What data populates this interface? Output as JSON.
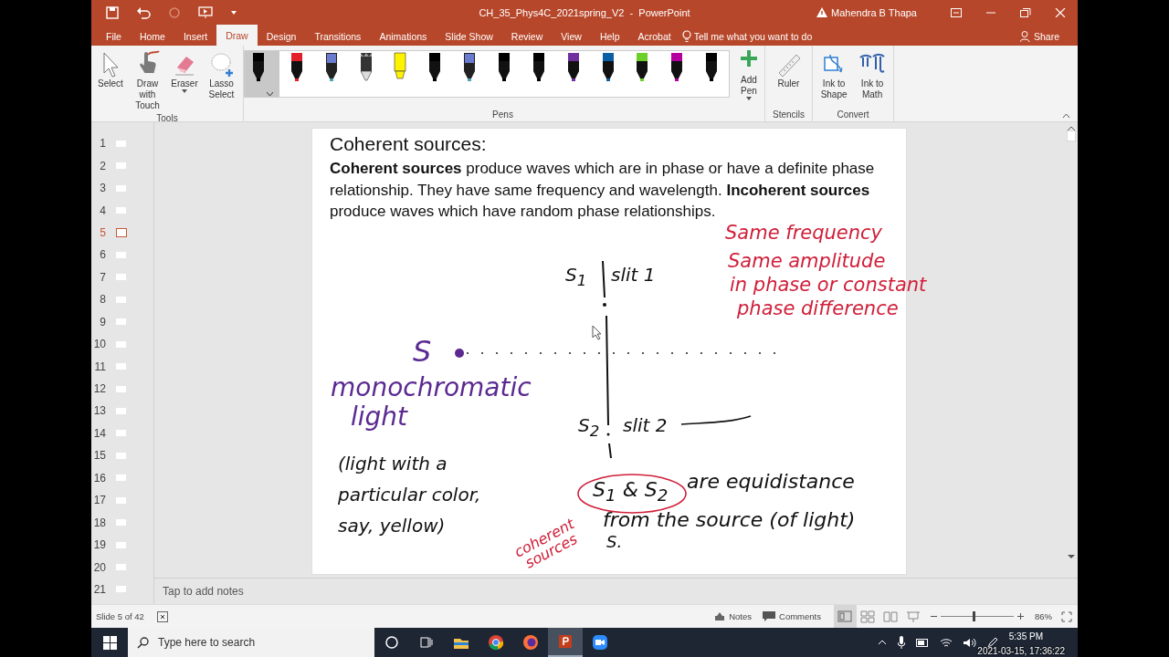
{
  "window": {
    "title": "CH_35_Phys4C_2021spring_V2  -  PowerPoint",
    "user": "Mahendra B Thapa"
  },
  "tabs": [
    {
      "label": "File",
      "selected": false
    },
    {
      "label": "Home",
      "selected": false
    },
    {
      "label": "Insert",
      "selected": false
    },
    {
      "label": "Draw",
      "selected": true
    },
    {
      "label": "Design",
      "selected": false
    },
    {
      "label": "Transitions",
      "selected": false
    },
    {
      "label": "Animations",
      "selected": false
    },
    {
      "label": "Slide Show",
      "selected": false
    },
    {
      "label": "Review",
      "selected": false
    },
    {
      "label": "View",
      "selected": false
    },
    {
      "label": "Help",
      "selected": false
    },
    {
      "label": "Acrobat",
      "selected": false
    }
  ],
  "tell_me": "Tell me what you want to do",
  "share": "Share",
  "ribbon": {
    "tools": {
      "label": "Tools",
      "buttons": [
        {
          "label": "Select",
          "dropdown": false
        },
        {
          "label": "Draw with Touch",
          "dropdown": false
        },
        {
          "label": "Eraser",
          "dropdown": true
        },
        {
          "label": "Lasso Select",
          "dropdown": false
        }
      ]
    },
    "pens": {
      "label": "Pens",
      "add_pen": "Add Pen",
      "items": [
        {
          "kind": "pen",
          "color": "#000000",
          "selected": true
        },
        {
          "kind": "pen",
          "color": "#e3202a",
          "selected": false
        },
        {
          "kind": "galaxy",
          "color": "#4fa3b8",
          "selected": false
        },
        {
          "kind": "pencil",
          "color": "#9a9a9a",
          "selected": false
        },
        {
          "kind": "highlighter",
          "color": "#fff200",
          "selected": false
        },
        {
          "kind": "pen",
          "color": "#000000",
          "selected": false
        },
        {
          "kind": "galaxy",
          "color": "#4fa3b8",
          "selected": false
        },
        {
          "kind": "pen",
          "color": "#000000",
          "selected": false
        },
        {
          "kind": "pen",
          "color": "#000000",
          "selected": false
        },
        {
          "kind": "pen",
          "color": "#7030a0",
          "selected": false
        },
        {
          "kind": "pen",
          "color": "#0b5fa5",
          "selected": false
        },
        {
          "kind": "pen",
          "color": "#6ccf2a",
          "selected": false
        },
        {
          "kind": "pen",
          "color": "#b4009e",
          "selected": false
        },
        {
          "kind": "pen",
          "color": "#000000",
          "selected": false
        }
      ]
    },
    "stencils": {
      "label": "Stencils",
      "buttons": [
        {
          "label": "Ruler"
        }
      ]
    },
    "convert": {
      "label": "Convert",
      "buttons": [
        {
          "label": "Ink to Shape"
        },
        {
          "label": "Ink to Math"
        }
      ]
    }
  },
  "thumbnails": [
    {
      "number": "1",
      "selected": false
    },
    {
      "number": "2",
      "selected": false
    },
    {
      "number": "3",
      "selected": false
    },
    {
      "number": "4",
      "selected": false
    },
    {
      "number": "5",
      "selected": true
    },
    {
      "number": "6",
      "selected": false
    },
    {
      "number": "7",
      "selected": false
    },
    {
      "number": "8",
      "selected": false
    },
    {
      "number": "9",
      "selected": false
    },
    {
      "number": "10",
      "selected": false
    },
    {
      "number": "11",
      "selected": false
    },
    {
      "number": "12",
      "selected": false
    },
    {
      "number": "13",
      "selected": false
    },
    {
      "number": "14",
      "selected": false
    },
    {
      "number": "15",
      "selected": false
    },
    {
      "number": "16",
      "selected": false
    },
    {
      "number": "17",
      "selected": false
    },
    {
      "number": "18",
      "selected": false
    },
    {
      "number": "19",
      "selected": false
    },
    {
      "number": "20",
      "selected": false
    },
    {
      "number": "21",
      "selected": false
    }
  ],
  "slide": {
    "title": "Coherent sources:",
    "body": "**Coherent sources** produce waves which are in phase or have a definite phase relationship. They have same frequency and wavelength. **Incoherent sources** produce waves which have random phase relationships.",
    "ink": [
      {
        "text": "Same frequency",
        "color": "#d0203a"
      },
      {
        "text": "Same amplitude",
        "color": "#d0203a"
      },
      {
        "text": "in phase or constant",
        "color": "#d0203a"
      },
      {
        "text": "phase difference",
        "color": "#d0203a"
      },
      {
        "text": "S$_{1}$",
        "color": "#111111"
      },
      {
        "text": "slit 1",
        "color": "#111111"
      },
      {
        "text": "S",
        "color": "#5b2a91"
      },
      {
        "text": "monochromatic",
        "color": "#5b2a91"
      },
      {
        "text": "light",
        "color": "#5b2a91"
      },
      {
        "text": "S$_{2}$",
        "color": "#111111"
      },
      {
        "text": "slit 2",
        "color": "#111111"
      },
      {
        "text": "(light with a particular color, say, yellow)",
        "color": "#111111"
      },
      {
        "text": "S$_{1}$ & S$_{2}$",
        "color": "#111111"
      },
      {
        "text": "are equidistance",
        "color": "#111111"
      },
      {
        "text": "from the source (of light)",
        "color": "#111111"
      },
      {
        "text": "S.",
        "color": "#111111"
      },
      {
        "text": "coherent sources",
        "color": "#d0203a"
      }
    ]
  },
  "notes_placeholder": "Tap to add notes",
  "status_bar": {
    "slide": "Slide 5 of 42",
    "notes": "Notes",
    "comments": "Comments",
    "views": [
      {
        "kind": "normal",
        "selected": true
      },
      {
        "kind": "sorter",
        "selected": false
      },
      {
        "kind": "reading",
        "selected": false
      },
      {
        "kind": "show",
        "selected": false
      }
    ],
    "zoom": "86%",
    "level": 0.45
  },
  "taskbar": {
    "search_placeholder": "Type here to search",
    "apps": [
      {
        "kind": "cortana",
        "selected": false
      },
      {
        "kind": "taskview",
        "selected": false
      },
      {
        "kind": "explorer",
        "selected": false
      },
      {
        "kind": "chrome",
        "selected": false
      },
      {
        "kind": "firefox",
        "selected": false
      },
      {
        "kind": "powerpoint",
        "selected": true
      },
      {
        "kind": "zoom",
        "selected": false
      }
    ],
    "time": "5:35 PM",
    "recording_timestamp": "2021-03-15, 17:36:22"
  }
}
